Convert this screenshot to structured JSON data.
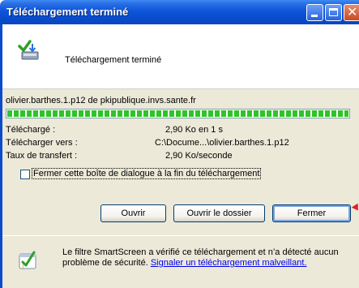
{
  "window": {
    "title": "Téléchargement terminé"
  },
  "header": {
    "status_text": "Téléchargement terminé",
    "icon": "download-complete-icon"
  },
  "download": {
    "source": "olivier.barthes.1.p12 de pkipublique.invs.sante.fr",
    "progress_percent": 100,
    "rows": [
      {
        "label": "Téléchargé :",
        "value": "2,90 Ko en 1 s"
      },
      {
        "label": "Télécharger vers :",
        "value": "C:\\Docume...\\olivier.barthes.1.p12"
      },
      {
        "label": "Taux de transfert :",
        "value": "2,90 Ko/seconde"
      }
    ]
  },
  "close_on_finish": {
    "label": "Fermer cette boîte de dialogue à la fin du téléchargement",
    "checked": false
  },
  "buttons": {
    "open": "Ouvrir",
    "open_folder": "Ouvrir le dossier",
    "close": "Fermer"
  },
  "smartscreen": {
    "message": "Le filtre SmartScreen a vérifié ce téléchargement et n’a détecté aucun problème de sécurité.",
    "link": "Signaler un téléchargement malveillant."
  },
  "colors": {
    "titlebar": "#0a4bcb",
    "progress": "#2fc32b",
    "dialog_bg": "#ece9d8"
  }
}
